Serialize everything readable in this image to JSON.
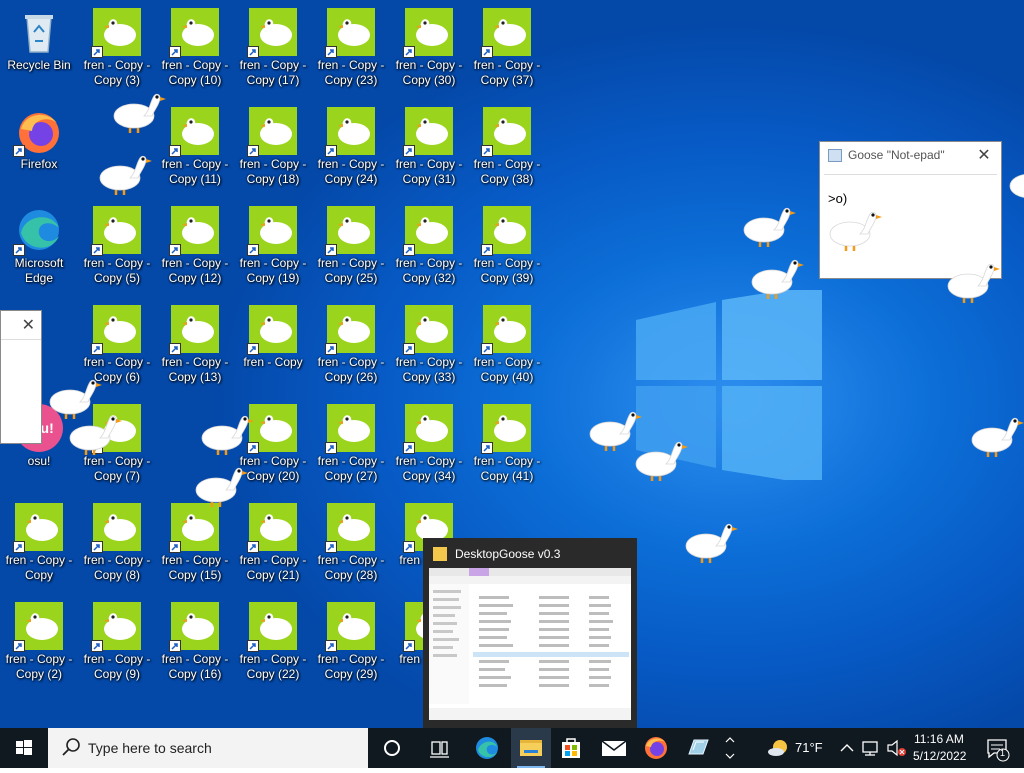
{
  "desktop": {
    "icons": [
      {
        "label": "Recycle Bin",
        "type": "recycle"
      },
      {
        "label": "Firefox",
        "type": "firefox"
      },
      {
        "label": "Microsoft Edge",
        "type": "edge"
      },
      {
        "label": "osu!",
        "type": "osu"
      },
      {
        "label": "fren - Copy - Copy",
        "type": "fren"
      },
      {
        "label": "fren - Copy - Copy (2)",
        "type": "fren"
      },
      {
        "label": "fren - Copy - Copy (3)",
        "type": "fren"
      },
      {
        "label": "fren - Copy - Copy (5)",
        "type": "fren"
      },
      {
        "label": "fren - Copy - Copy (6)",
        "type": "fren"
      },
      {
        "label": "fren - Copy - Copy (7)",
        "type": "fren"
      },
      {
        "label": "fren - Copy - Copy (8)",
        "type": "fren"
      },
      {
        "label": "fren - Copy - Copy (9)",
        "type": "fren"
      },
      {
        "label": "fren - Copy - Copy (10)",
        "type": "fren"
      },
      {
        "label": "fren - Copy - Copy (11)",
        "type": "fren"
      },
      {
        "label": "fren - Copy - Copy (12)",
        "type": "fren"
      },
      {
        "label": "fren - Copy - Copy (13)",
        "type": "fren"
      },
      {
        "label": "fren - Copy - Copy (15)",
        "type": "fren"
      },
      {
        "label": "fren - Copy - Copy (16)",
        "type": "fren"
      },
      {
        "label": "fren - Copy - Copy (17)",
        "type": "fren"
      },
      {
        "label": "fren - Copy - Copy (18)",
        "type": "fren"
      },
      {
        "label": "fren - Copy - Copy (19)",
        "type": "fren"
      },
      {
        "label": "fren - Copy",
        "type": "fren"
      },
      {
        "label": "fren - Copy - Copy (20)",
        "type": "fren"
      },
      {
        "label": "fren - Copy - Copy (21)",
        "type": "fren"
      },
      {
        "label": "fren - Copy - Copy (22)",
        "type": "fren"
      },
      {
        "label": "fren - Copy - Copy (23)",
        "type": "fren"
      },
      {
        "label": "fren - Copy - Copy (24)",
        "type": "fren"
      },
      {
        "label": "fren - Copy - Copy (25)",
        "type": "fren"
      },
      {
        "label": "fren - Copy - Copy (26)",
        "type": "fren"
      },
      {
        "label": "fren - Copy - Copy (27)",
        "type": "fren"
      },
      {
        "label": "fren - Copy - Copy (28)",
        "type": "fren"
      },
      {
        "label": "fren - Copy - Copy (29)",
        "type": "fren"
      },
      {
        "label": "fren - Copy - Copy (30)",
        "type": "fren"
      },
      {
        "label": "fren - Copy - Copy (31)",
        "type": "fren"
      },
      {
        "label": "fren - Copy - Copy (32)",
        "type": "fren"
      },
      {
        "label": "fren - Copy - Copy (33)",
        "type": "fren"
      },
      {
        "label": "fren - Copy - Copy (34)",
        "type": "fren"
      },
      {
        "label": "fren - Copy",
        "type": "fren"
      },
      {
        "label": "fren - Copy",
        "type": "fren"
      },
      {
        "label": "fren - Copy - Copy (37)",
        "type": "fren"
      },
      {
        "label": "fren - Copy - Copy (38)",
        "type": "fren"
      },
      {
        "label": "fren - Copy - Copy (39)",
        "type": "fren"
      },
      {
        "label": "fren - Copy - Copy (40)",
        "type": "fren"
      },
      {
        "label": "fren - Copy - Copy (41)",
        "type": "fren"
      }
    ]
  },
  "notepad": {
    "title": "Goose \"Not-epad\"",
    "close_glyph": "✕",
    "text": ">o)"
  },
  "left_window": {
    "close_glyph": "✕"
  },
  "taskbar_preview": {
    "title": "DesktopGoose v0.3"
  },
  "taskbar": {
    "search_placeholder": "Type here to search",
    "apps": [
      "cortana-icon",
      "task-view-icon",
      "edge-icon",
      "file-explorer-icon",
      "store-icon",
      "mail-icon",
      "firefox-icon",
      "desktopgoose-icon"
    ],
    "weather": {
      "temp": "71°F"
    },
    "clock": {
      "time": "11:16 AM",
      "date": "5/12/2022"
    },
    "notification_count": "1",
    "colors": {
      "taskbar": "#101820",
      "accent": "#7fb8f0"
    }
  },
  "colors": {
    "wallpaper": "#0d6fd8",
    "fren_bg": "#9bd41d"
  }
}
